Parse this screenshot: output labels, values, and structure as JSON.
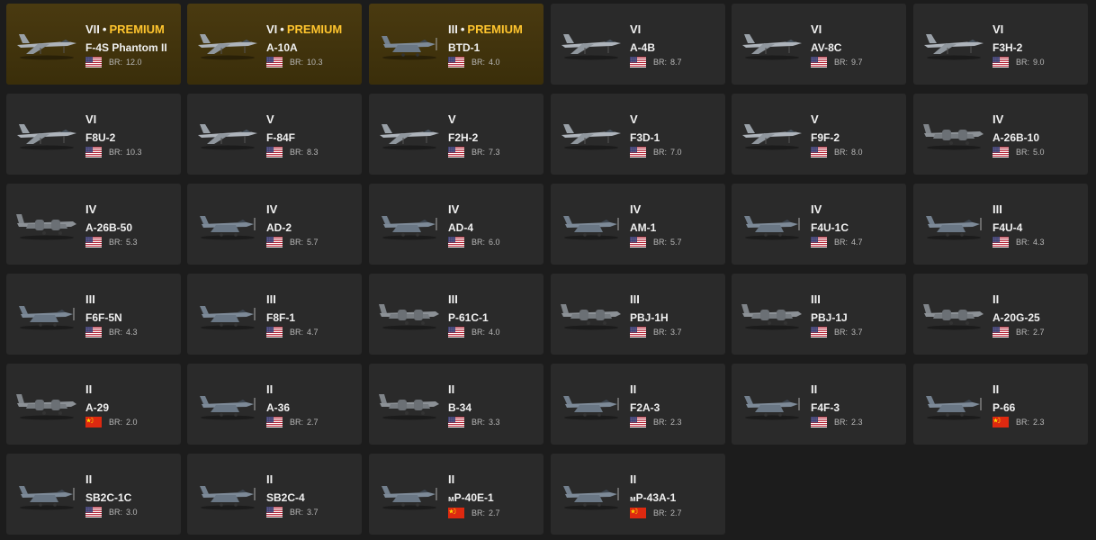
{
  "br_label": "BR:",
  "premium_label": "PREMIUM",
  "flag_colors": {
    "usa_blue": "#3c3b6e",
    "usa_red": "#b22234",
    "china_red": "#de2910",
    "china_star": "#ffde00"
  },
  "accent_color": "#ffc52e",
  "vehicles": [
    {
      "rank": "VII",
      "premium": true,
      "tag": "",
      "name": "F-4S Phantom II",
      "flag": "usa-flag-icon",
      "br": "12.0",
      "plane": "jet"
    },
    {
      "rank": "VI",
      "premium": true,
      "tag": "",
      "name": "A-10A",
      "flag": "usa-flag-icon",
      "br": "10.3",
      "plane": "jet"
    },
    {
      "rank": "III",
      "premium": true,
      "tag": "",
      "name": "BTD-1",
      "flag": "usa-flag-icon",
      "br": "4.0",
      "plane": "prop"
    },
    {
      "rank": "VI",
      "premium": false,
      "tag": "",
      "name": "A-4B",
      "flag": "usa-flag-icon",
      "br": "8.7",
      "plane": "jet"
    },
    {
      "rank": "VI",
      "premium": false,
      "tag": "",
      "name": "AV-8C",
      "flag": "usa-flag-icon",
      "br": "9.7",
      "plane": "jet"
    },
    {
      "rank": "VI",
      "premium": false,
      "tag": "",
      "name": "F3H-2",
      "flag": "usa-flag-icon",
      "br": "9.0",
      "plane": "jet"
    },
    {
      "rank": "VI",
      "premium": false,
      "tag": "",
      "name": "F8U-2",
      "flag": "usa-flag-icon",
      "br": "10.3",
      "plane": "jet"
    },
    {
      "rank": "V",
      "premium": false,
      "tag": "",
      "name": "F-84F",
      "flag": "usa-flag-icon",
      "br": "8.3",
      "plane": "jet"
    },
    {
      "rank": "V",
      "premium": false,
      "tag": "",
      "name": "F2H-2",
      "flag": "usa-flag-icon",
      "br": "7.3",
      "plane": "jet"
    },
    {
      "rank": "V",
      "premium": false,
      "tag": "",
      "name": "F3D-1",
      "flag": "usa-flag-icon",
      "br": "7.0",
      "plane": "jet"
    },
    {
      "rank": "V",
      "premium": false,
      "tag": "",
      "name": "F9F-2",
      "flag": "usa-flag-icon",
      "br": "8.0",
      "plane": "jet"
    },
    {
      "rank": "IV",
      "premium": false,
      "tag": "",
      "name": "A-26B-10",
      "flag": "usa-flag-icon",
      "br": "5.0",
      "plane": "twin"
    },
    {
      "rank": "IV",
      "premium": false,
      "tag": "",
      "name": "A-26B-50",
      "flag": "usa-flag-icon",
      "br": "5.3",
      "plane": "twin"
    },
    {
      "rank": "IV",
      "premium": false,
      "tag": "",
      "name": "AD-2",
      "flag": "usa-flag-icon",
      "br": "5.7",
      "plane": "prop"
    },
    {
      "rank": "IV",
      "premium": false,
      "tag": "",
      "name": "AD-4",
      "flag": "usa-flag-icon",
      "br": "6.0",
      "plane": "prop"
    },
    {
      "rank": "IV",
      "premium": false,
      "tag": "",
      "name": "AM-1",
      "flag": "usa-flag-icon",
      "br": "5.7",
      "plane": "prop"
    },
    {
      "rank": "IV",
      "premium": false,
      "tag": "",
      "name": "F4U-1C",
      "flag": "usa-flag-icon",
      "br": "4.7",
      "plane": "prop"
    },
    {
      "rank": "III",
      "premium": false,
      "tag": "",
      "name": "F4U-4",
      "flag": "usa-flag-icon",
      "br": "4.3",
      "plane": "prop"
    },
    {
      "rank": "III",
      "premium": false,
      "tag": "",
      "name": "F6F-5N",
      "flag": "usa-flag-icon",
      "br": "4.3",
      "plane": "prop"
    },
    {
      "rank": "III",
      "premium": false,
      "tag": "",
      "name": "F8F-1",
      "flag": "usa-flag-icon",
      "br": "4.7",
      "plane": "prop"
    },
    {
      "rank": "III",
      "premium": false,
      "tag": "",
      "name": "P-61C-1",
      "flag": "usa-flag-icon",
      "br": "4.0",
      "plane": "twin"
    },
    {
      "rank": "III",
      "premium": false,
      "tag": "",
      "name": "PBJ-1H",
      "flag": "usa-flag-icon",
      "br": "3.7",
      "plane": "twin"
    },
    {
      "rank": "III",
      "premium": false,
      "tag": "",
      "name": "PBJ-1J",
      "flag": "usa-flag-icon",
      "br": "3.7",
      "plane": "twin"
    },
    {
      "rank": "II",
      "premium": false,
      "tag": "",
      "name": "A-20G-25",
      "flag": "usa-flag-icon",
      "br": "2.7",
      "plane": "twin"
    },
    {
      "rank": "II",
      "premium": false,
      "tag": "",
      "name": "A-29",
      "flag": "china-flag-icon",
      "br": "2.0",
      "plane": "twin"
    },
    {
      "rank": "II",
      "premium": false,
      "tag": "",
      "name": "A-36",
      "flag": "usa-flag-icon",
      "br": "2.7",
      "plane": "prop"
    },
    {
      "rank": "II",
      "premium": false,
      "tag": "",
      "name": "B-34",
      "flag": "usa-flag-icon",
      "br": "3.3",
      "plane": "twin"
    },
    {
      "rank": "II",
      "premium": false,
      "tag": "",
      "name": "F2A-3",
      "flag": "usa-flag-icon",
      "br": "2.3",
      "plane": "prop"
    },
    {
      "rank": "II",
      "premium": false,
      "tag": "",
      "name": "F4F-3",
      "flag": "usa-flag-icon",
      "br": "2.3",
      "plane": "prop"
    },
    {
      "rank": "II",
      "premium": false,
      "tag": "",
      "name": "P-66",
      "flag": "china-flag-icon",
      "br": "2.3",
      "plane": "prop"
    },
    {
      "rank": "II",
      "premium": false,
      "tag": "",
      "name": "SB2C-1C",
      "flag": "usa-flag-icon",
      "br": "3.0",
      "plane": "prop"
    },
    {
      "rank": "II",
      "premium": false,
      "tag": "",
      "name": "SB2C-4",
      "flag": "usa-flag-icon",
      "br": "3.7",
      "plane": "prop"
    },
    {
      "rank": "II",
      "premium": false,
      "tag": "ᴍ",
      "name": "P-40E-1",
      "flag": "china-flag-icon",
      "br": "2.7",
      "plane": "prop"
    },
    {
      "rank": "II",
      "premium": false,
      "tag": "ᴍ",
      "name": "P-43A-1",
      "flag": "china-flag-icon",
      "br": "2.7",
      "plane": "prop"
    }
  ]
}
